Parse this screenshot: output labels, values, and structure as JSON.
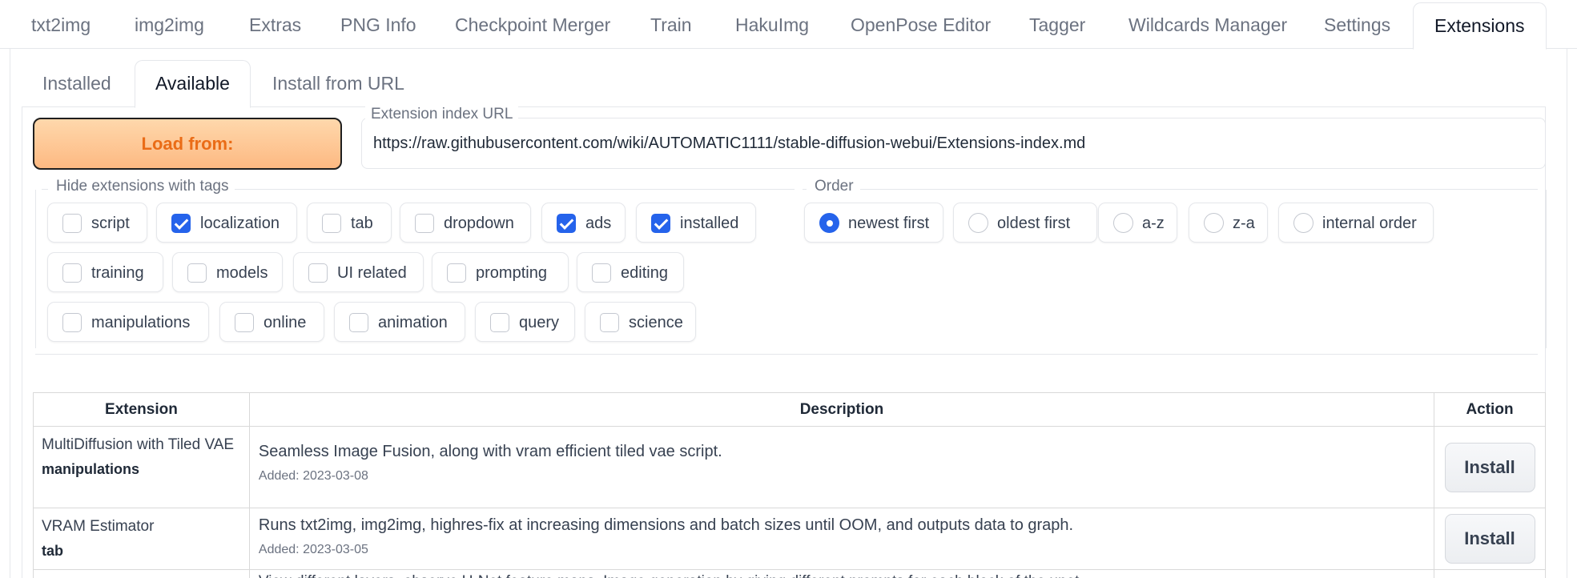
{
  "top_tabs": [
    "txt2img",
    "img2img",
    "Extras",
    "PNG Info",
    "Checkpoint Merger",
    "Train",
    "HakuImg",
    "OpenPose Editor",
    "Tagger",
    "Wildcards Manager",
    "Settings",
    "Extensions"
  ],
  "active_top_tab": "Extensions",
  "sub_tabs": [
    "Installed",
    "Available",
    "Install from URL"
  ],
  "active_sub_tab": "Available",
  "load_button": "Load from:",
  "index_url": {
    "label": "Extension index URL",
    "value": "https://raw.githubusercontent.com/wiki/AUTOMATIC1111/stable-diffusion-webui/Extensions-index.md"
  },
  "hide_tags": {
    "label": "Hide extensions with tags",
    "tags": [
      {
        "label": "script",
        "checked": false
      },
      {
        "label": "localization",
        "checked": true
      },
      {
        "label": "tab",
        "checked": false
      },
      {
        "label": "dropdown",
        "checked": false
      },
      {
        "label": "ads",
        "checked": true
      },
      {
        "label": "installed",
        "checked": true
      },
      {
        "label": "training",
        "checked": false
      },
      {
        "label": "models",
        "checked": false
      },
      {
        "label": "UI related",
        "checked": false
      },
      {
        "label": "prompting",
        "checked": false
      },
      {
        "label": "editing",
        "checked": false
      },
      {
        "label": "manipulations",
        "checked": false
      },
      {
        "label": "online",
        "checked": false
      },
      {
        "label": "animation",
        "checked": false
      },
      {
        "label": "query",
        "checked": false
      },
      {
        "label": "science",
        "checked": false
      }
    ]
  },
  "order": {
    "label": "Order",
    "options": [
      {
        "label": "newest first",
        "selected": true
      },
      {
        "label": "oldest first",
        "selected": false
      },
      {
        "label": "a-z",
        "selected": false
      },
      {
        "label": "z-a",
        "selected": false
      },
      {
        "label": "internal order",
        "selected": false
      }
    ]
  },
  "table": {
    "headers": [
      "Extension",
      "Description",
      "Action"
    ],
    "rows": [
      {
        "name": "MultiDiffusion with Tiled VAE",
        "tag": "manipulations",
        "description": "Seamless Image Fusion, along with vram efficient tiled vae script.",
        "added": "Added: 2023-03-08",
        "action": "Install"
      },
      {
        "name": "VRAM Estimator",
        "tag": "tab",
        "description": "Runs txt2img, img2img, highres-fix at increasing dimensions and batch sizes until OOM, and outputs data to graph.",
        "added": "Added: 2023-03-05",
        "action": "Install"
      }
    ],
    "partial_row_text": "View different layers, observe U-Net feature maps. Image generation by giving different prompts for each block of the unet"
  }
}
